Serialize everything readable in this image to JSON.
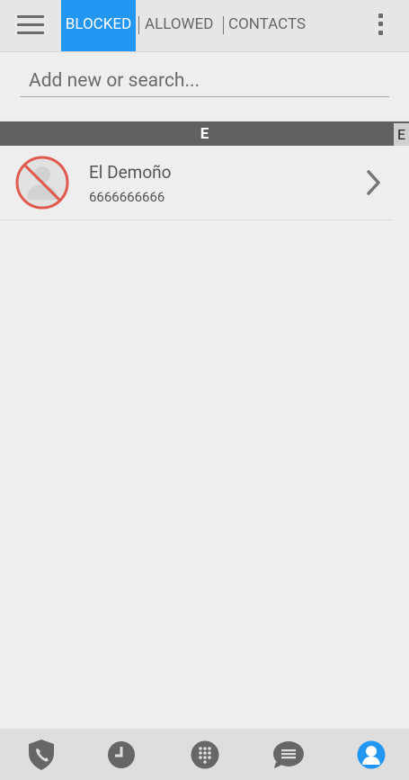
{
  "tabs": [
    {
      "label": "BLOCKED",
      "active": true
    },
    {
      "label": "ALLOWED",
      "active": false
    },
    {
      "label": "CONTACTS",
      "active": false
    }
  ],
  "search": {
    "placeholder": "Add new or search...",
    "value": ""
  },
  "section": {
    "letter": "E",
    "index_letter": "E"
  },
  "contacts": [
    {
      "name": "El Demoño",
      "number": "6666666666",
      "status": "blocked"
    }
  ],
  "bottom_nav": [
    {
      "icon": "shield-phone-icon",
      "active": false
    },
    {
      "icon": "clock-icon",
      "active": false
    },
    {
      "icon": "dialpad-icon",
      "active": false
    },
    {
      "icon": "message-icon",
      "active": false
    },
    {
      "icon": "contact-person-icon",
      "active": true
    }
  ],
  "colors": {
    "accent": "#2196f3",
    "topbar_bg": "#e6e6e6",
    "page_bg": "#eeeeee",
    "section_header_bg": "#616161",
    "bottom_nav_bg": "#dedede",
    "icon_gray": "#666666",
    "blocked_red": "#e05a4f"
  }
}
